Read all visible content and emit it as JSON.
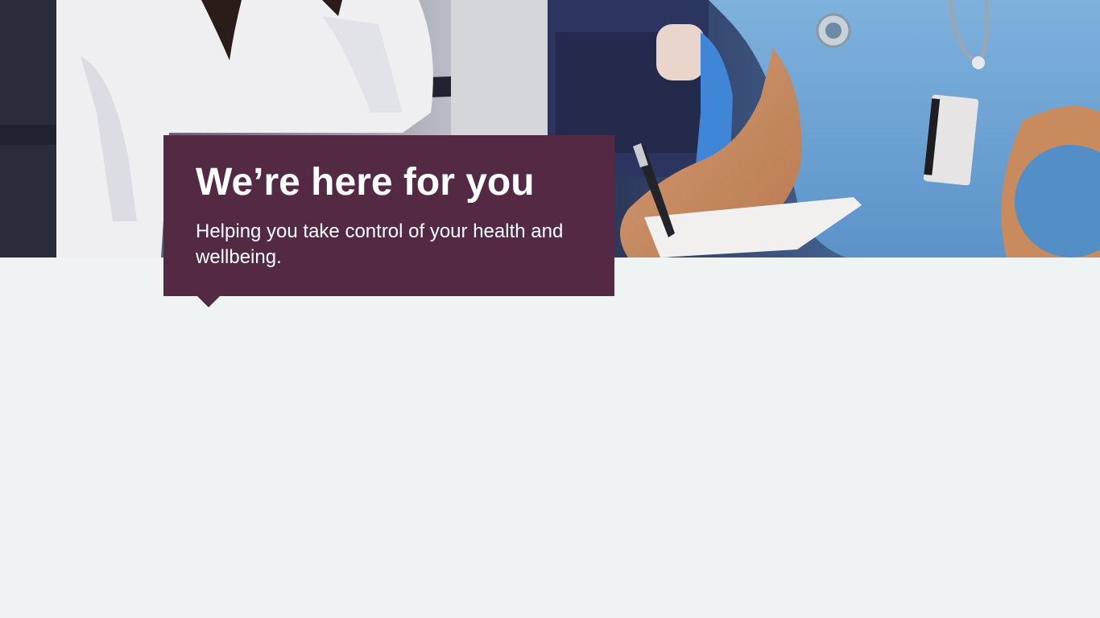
{
  "hero": {
    "title": "We’re here for you",
    "subtitle": "Helping you take control of your health and wellbeing."
  },
  "colors": {
    "card_background": "#532944",
    "page_background": "#f0f3f4",
    "text": "#ffffff"
  },
  "hero_image": {
    "icon": "photo-patient-and-nurse-with-clipboard"
  }
}
